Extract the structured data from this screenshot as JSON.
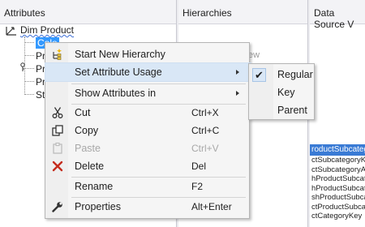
{
  "panes": {
    "attributes": "Attributes",
    "hierarchies": "Hierarchies",
    "data_source_view": "Data Source V"
  },
  "tree": {
    "root": "Dim Product",
    "items": [
      "Colo",
      "Pr",
      "Pr",
      "Pr",
      "St"
    ]
  },
  "hierarchies_hint": "ew",
  "dsv": {
    "title": "roductSubcategor",
    "rows": [
      "ctSubcategoryKe",
      "ctSubcategoryA",
      "hProductSubcate",
      "hProductSubcate",
      "shProductSubcate",
      "ctProductSubcate",
      "ctCategoryKey"
    ]
  },
  "context_menu": {
    "items": [
      {
        "label": "Start New Hierarchy",
        "icon": "new-hierarchy-icon"
      },
      {
        "label": "Set Attribute Usage",
        "icon": ""
      },
      {
        "label": "Show Attributes in",
        "icon": ""
      },
      {
        "label": "Cut",
        "shortcut": "Ctrl+X",
        "icon": "scissors-icon"
      },
      {
        "label": "Copy",
        "shortcut": "Ctrl+C",
        "icon": "copy-icon"
      },
      {
        "label": "Paste",
        "shortcut": "Ctrl+V",
        "icon": "paste-icon",
        "disabled": true
      },
      {
        "label": "Delete",
        "shortcut": "Del",
        "icon": "delete-x-icon"
      },
      {
        "label": "Rename",
        "shortcut": "F2",
        "icon": ""
      },
      {
        "label": "Properties",
        "shortcut": "Alt+Enter",
        "icon": "wrench-icon"
      }
    ]
  },
  "submenu": {
    "items": [
      "Regular",
      "Key",
      "Parent"
    ],
    "checked": "Regular"
  },
  "colors": {
    "selection": "#3399ff",
    "highlight": "#d9e7f6",
    "delete_red": "#c42b1c"
  }
}
